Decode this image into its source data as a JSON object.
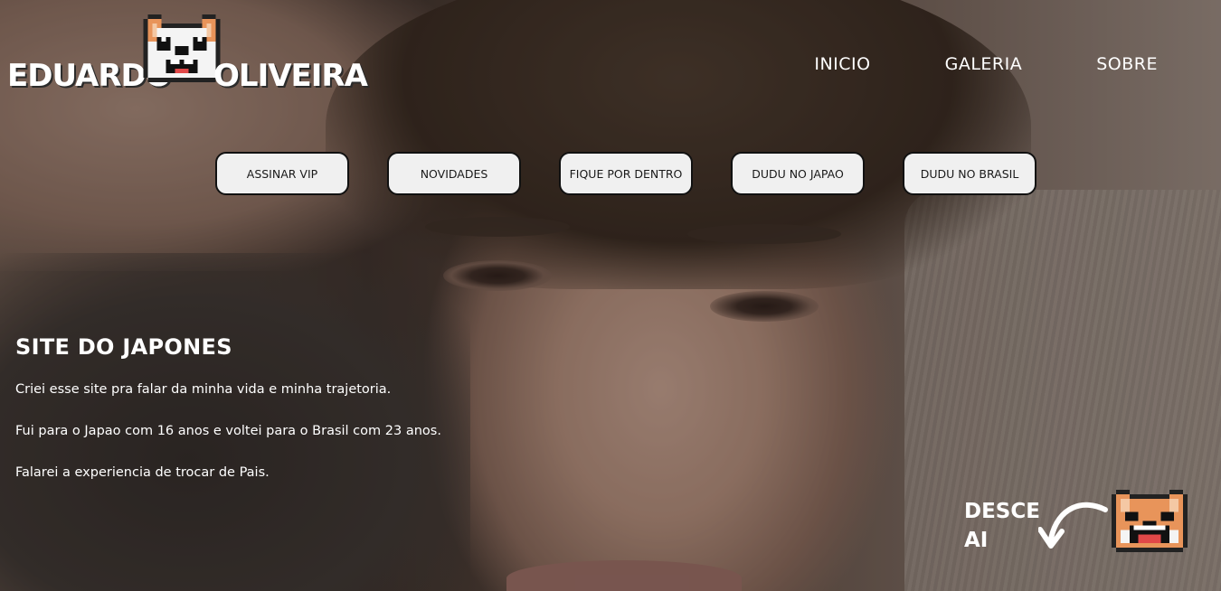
{
  "logo": {
    "first_word": "EDUARDO",
    "last_word": "OLIVEIRA",
    "mascot_icon": "pixel-dog-icon"
  },
  "nav": {
    "items": [
      {
        "label": "INICIO"
      },
      {
        "label": "GALERIA"
      },
      {
        "label": "SOBRE"
      }
    ]
  },
  "buttons": [
    {
      "label": "ASSINAR VIP"
    },
    {
      "label": "NOVIDADES"
    },
    {
      "label": "FIQUE POR DENTRO"
    },
    {
      "label": "DUDU NO JAPAO"
    },
    {
      "label": "DUDU NO BRASIL"
    }
  ],
  "intro": {
    "title": "SITE DO JAPONES",
    "paragraphs": [
      "Criei esse site pra falar da minha vida e minha trajetoria.",
      "Fui para o Japao com 16 anos e voltei para o Brasil com 23 anos.",
      "Falarei a experiencia de trocar de Pais."
    ]
  },
  "scroll_hint": {
    "line1": "DESCE",
    "line2": "AI",
    "arrow_icon": "curved-arrow-icon",
    "mascot_icon": "pixel-dog-icon"
  },
  "colors": {
    "text": "#ffffff",
    "button_bg": "#f0f0f0",
    "button_border": "#111111",
    "dog_orange": "#e8945a",
    "dog_white": "#f4f4f4"
  }
}
